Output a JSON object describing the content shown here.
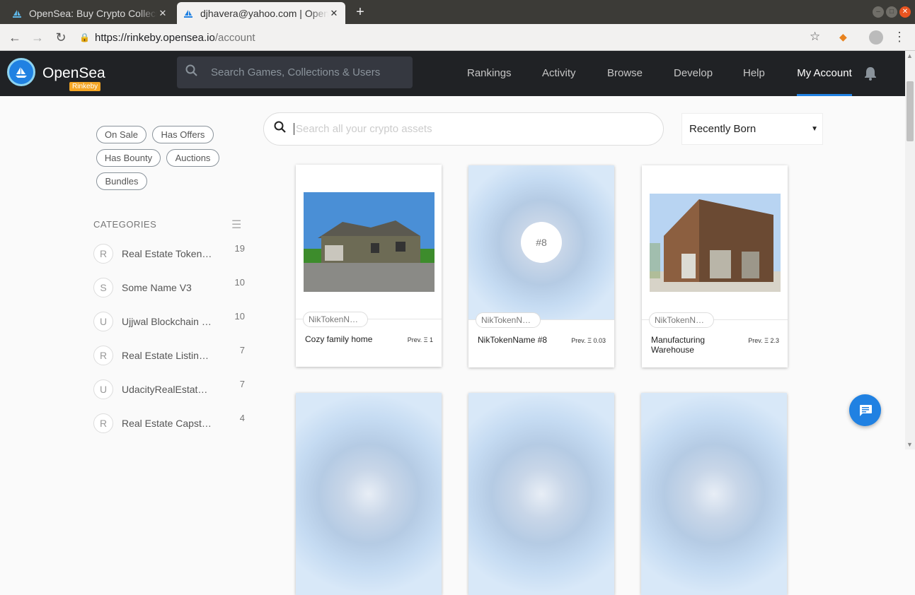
{
  "browser": {
    "tabs": [
      {
        "label": "OpenSea: Buy Crypto Collectibles",
        "icon": "opensea-favicon",
        "close": "✕"
      },
      {
        "label": "djhavera@yahoo.com | OpenSea",
        "icon": "opensea-favicon",
        "close": "✕"
      }
    ],
    "new_tab": "+",
    "url_host": "https://rinkeby.opensea.io",
    "url_path": "/account"
  },
  "header": {
    "brand": "OpenSea",
    "network_badge": "Rinkeby",
    "search_placeholder": "Search Games, Collections & Users",
    "nav": [
      "Rankings",
      "Activity",
      "Browse",
      "Develop",
      "Help",
      "My Account"
    ],
    "active_nav": "My Account",
    "accent_color": "#2081e2",
    "header_bg": "#202225"
  },
  "filters": [
    "On Sale",
    "Has Offers",
    "Has Bounty",
    "Auctions",
    "Bundles"
  ],
  "categories": {
    "title": "CATEGORIES",
    "items": [
      {
        "initial": "R",
        "name": "Real Estate Token…",
        "count": "19"
      },
      {
        "initial": "S",
        "name": "Some Name V3",
        "count": "10"
      },
      {
        "initial": "U",
        "name": "Ujjwal Blockchain …",
        "count": "10"
      },
      {
        "initial": "R",
        "name": "Real Estate Listin…",
        "count": "7"
      },
      {
        "initial": "U",
        "name": "UdacityRealEstat…",
        "count": "7"
      },
      {
        "initial": "R",
        "name": "Real Estate Capst…",
        "count": "4"
      }
    ]
  },
  "asset_search": {
    "placeholder": "Search all your crypto assets"
  },
  "sort": {
    "selected": "Recently Born"
  },
  "cards": [
    {
      "collection": "NikTokenNa…",
      "name": "Cozy family home",
      "price": "Prev. Ξ 1",
      "image": "house-photo"
    },
    {
      "collection": "NikTokenNa…",
      "name": "NikTokenName #8",
      "price": "Prev. Ξ 0.03",
      "image": "token-placeholder",
      "badge": "#8"
    },
    {
      "collection": "NikTokenNa…",
      "name": "Manufacturing Warehouse",
      "price": "Prev. Ξ 2.3",
      "image": "barn-photo"
    }
  ]
}
